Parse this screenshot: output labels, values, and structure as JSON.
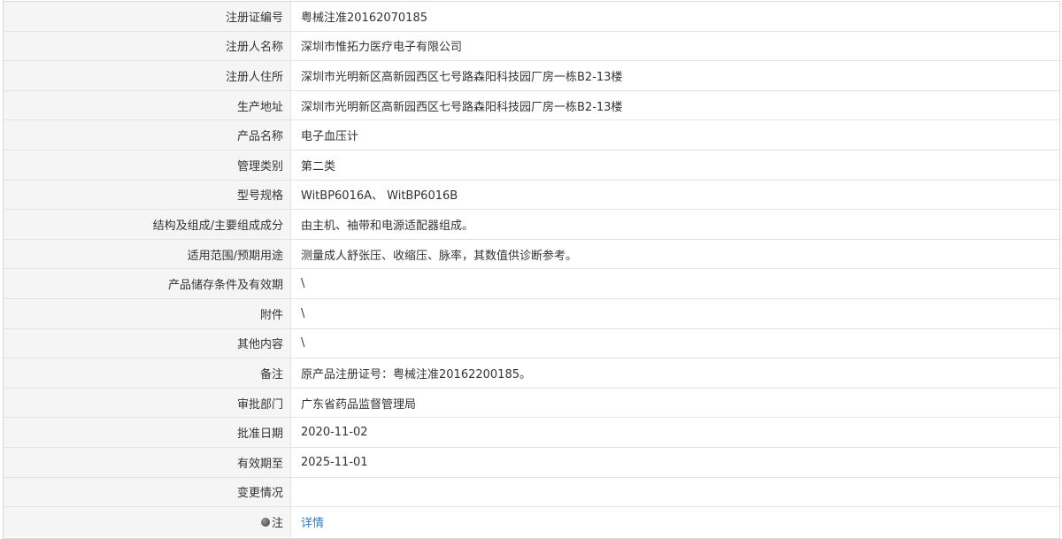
{
  "rows": [
    {
      "label": "注册证编号",
      "value": "粤械注准20162070185"
    },
    {
      "label": "注册人名称",
      "value": "深圳市惟拓力医疗电子有限公司"
    },
    {
      "label": "注册人住所",
      "value": "深圳市光明新区高新园西区七号路森阳科技园厂房一栋B2-13楼"
    },
    {
      "label": "生产地址",
      "value": "深圳市光明新区高新园西区七号路森阳科技园厂房一栋B2-13楼"
    },
    {
      "label": "产品名称",
      "value": "电子血压计"
    },
    {
      "label": "管理类别",
      "value": "第二类"
    },
    {
      "label": "型号规格",
      "value": "WitBP6016A、 WitBP6016B"
    },
    {
      "label": "结构及组成/主要组成成分",
      "value": "由主机、袖带和电源适配器组成。"
    },
    {
      "label": "适用范围/预期用途",
      "value": "测量成人舒张压、收缩压、脉率，其数值供诊断参考。"
    },
    {
      "label": "产品储存条件及有效期",
      "value": "\\"
    },
    {
      "label": "附件",
      "value": "\\"
    },
    {
      "label": "其他内容",
      "value": "\\"
    },
    {
      "label": "备注",
      "value": "原产品注册证号：粤械注准20162200185。"
    },
    {
      "label": "审批部门",
      "value": "广东省药品监督管理局"
    },
    {
      "label": "批准日期",
      "value": "2020-11-02"
    },
    {
      "label": "有效期至",
      "value": "2025-11-01"
    },
    {
      "label": "变更情况",
      "value": ""
    }
  ],
  "note": {
    "label": "注",
    "icon": "note-icon",
    "link_label": "详情"
  },
  "colors": {
    "link": "#2d7cc6",
    "label_bg": "#f5f5f5",
    "border": "#e3e3e3"
  }
}
